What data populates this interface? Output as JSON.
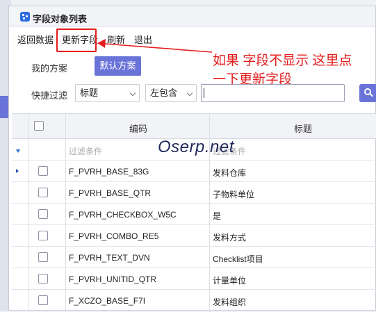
{
  "window": {
    "title": "字段对象列表"
  },
  "menu": {
    "items": [
      {
        "name": "menu-return-data",
        "label": "返回数据"
      },
      {
        "name": "menu-update-fields",
        "label": "更新字段"
      },
      {
        "name": "menu-refresh",
        "label": "刷新"
      },
      {
        "name": "menu-exit",
        "label": "退出"
      }
    ]
  },
  "annotation": {
    "line1": "如果 字段不显示  这里点",
    "line2": "一下更新字段",
    "color": "#e51c1c"
  },
  "scheme": {
    "label": "我的方案",
    "button": "默认方案"
  },
  "filter": {
    "label": "快捷过滤",
    "field_select": "标题",
    "operator_select": "左包含",
    "value": ""
  },
  "grid": {
    "columns": [
      "编码",
      "标题"
    ],
    "filter_row": {
      "code_placeholder": "过滤条件",
      "title_placeholder": "过滤条件"
    },
    "rows": [
      {
        "code": "F_PVRH_BASE_83G",
        "title": "发料仓库"
      },
      {
        "code": "F_PVRH_BASE_QTR",
        "title": "子物料单位"
      },
      {
        "code": "F_PVRH_CHECKBOX_W5C",
        "title": "是"
      },
      {
        "code": "F_PVRH_COMBO_RE5",
        "title": "发料方式"
      },
      {
        "code": "F_PVRH_TEXT_DVN",
        "title": "Checklist项目"
      },
      {
        "code": "F_PVRH_UNITID_QTR",
        "title": "计量单位"
      },
      {
        "code": "F_XCZO_BASE_F7I",
        "title": "发料组织"
      }
    ]
  },
  "watermark": "Oserp.net",
  "colors": {
    "accent": "#6a73d8",
    "brand_blue": "#2d6de3"
  }
}
